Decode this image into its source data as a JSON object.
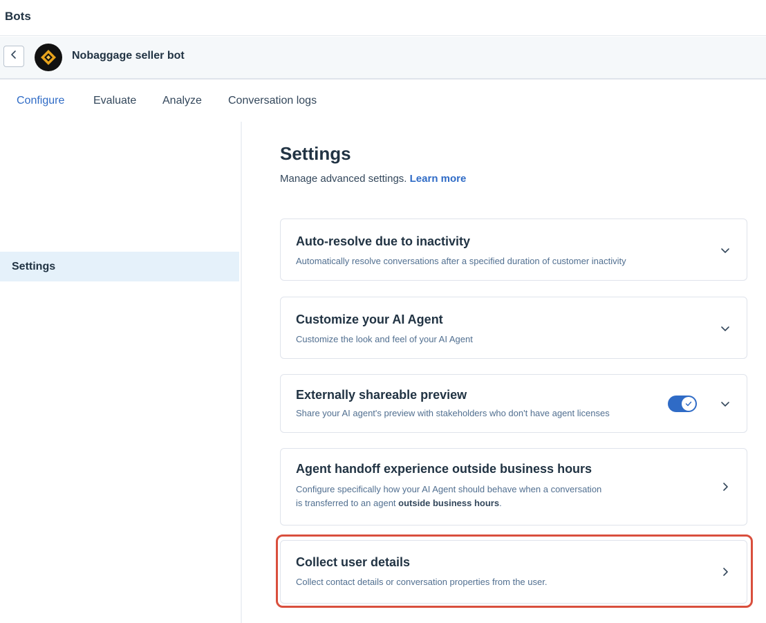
{
  "topbar": {
    "title": "Bots"
  },
  "bot": {
    "name": "Nobaggage seller bot"
  },
  "tabs": [
    {
      "label": "Configure",
      "active": true
    },
    {
      "label": "Evaluate",
      "active": false
    },
    {
      "label": "Analyze",
      "active": false
    },
    {
      "label": "Conversation logs",
      "active": false
    }
  ],
  "sidebar": {
    "items": [
      {
        "label": "Settings",
        "selected": true
      }
    ]
  },
  "main": {
    "title": "Settings",
    "subtitle": "Manage advanced settings.",
    "learn_more": "Learn more"
  },
  "cards": [
    {
      "title": "Auto-resolve due to inactivity",
      "desc": "Automatically resolve conversations after a specified duration of customer inactivity",
      "control": "chevron-down"
    },
    {
      "title": "Customize your AI Agent",
      "desc": "Customize the look and feel of your AI Agent",
      "control": "chevron-down"
    },
    {
      "title": "Externally shareable preview",
      "desc": "Share your AI agent's preview with stakeholders who don't have agent licenses",
      "control": "chevron-down",
      "toggle_on": true
    },
    {
      "title": "Agent handoff experience outside business hours",
      "desc_line1": "Configure specifically how your AI Agent should behave when a conversation",
      "desc_line2_prefix": "is transferred to an agent",
      "desc_line2_bold": "outside business hours",
      "desc_line2_suffix": ".",
      "control": "chevron-right"
    },
    {
      "title": "Collect user details",
      "desc": "Collect contact details or conversation properties from the user.",
      "control": "chevron-right",
      "highlighted": true
    }
  ],
  "colors": {
    "accent": "#2f6bc6",
    "highlight": "#d94f3d",
    "selected_bg": "#e5f1fa"
  }
}
